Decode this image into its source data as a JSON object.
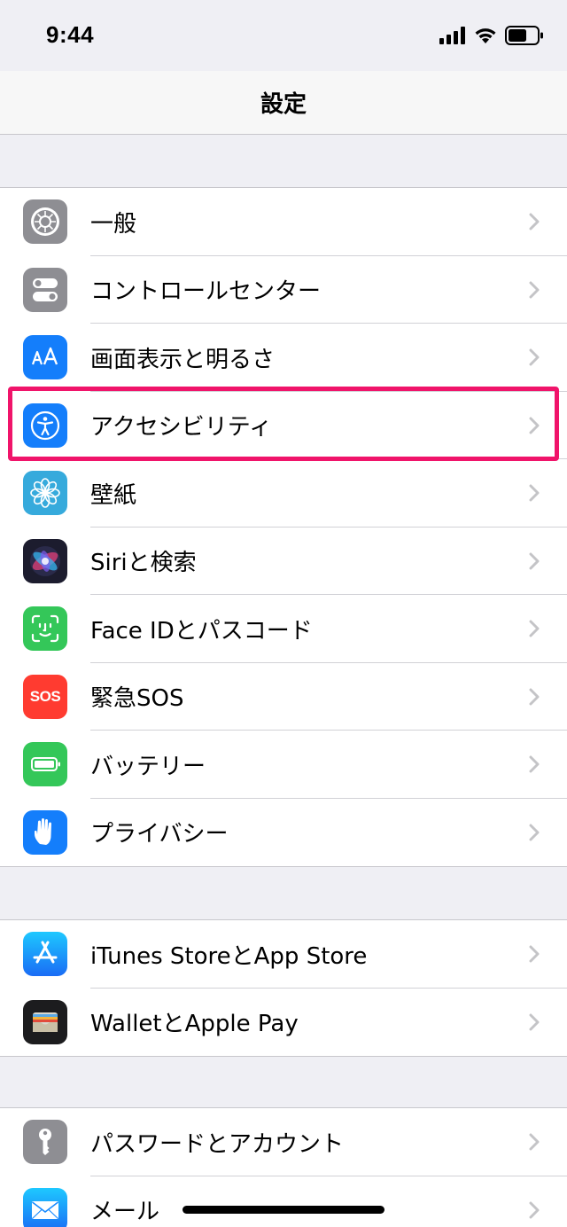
{
  "status": {
    "time": "9:44"
  },
  "nav": {
    "title": "設定"
  },
  "sections": [
    {
      "items": [
        {
          "label": "一般",
          "icon": "gear-icon",
          "color": "#8e8e93"
        },
        {
          "label": "コントロールセンター",
          "icon": "toggles-icon",
          "color": "#8e8e93"
        },
        {
          "label": "画面表示と明るさ",
          "icon": "text-size-icon",
          "color": "#147efb"
        },
        {
          "label": "アクセシビリティ",
          "icon": "accessibility-icon",
          "color": "#147efb"
        },
        {
          "label": "壁紙",
          "icon": "wallpaper-flower-icon",
          "color": "#36aadc"
        },
        {
          "label": "Siriと検索",
          "icon": "siri-icon",
          "color": "#1c1c2e"
        },
        {
          "label": "Face IDとパスコード",
          "icon": "face-id-icon",
          "color": "#34c759"
        },
        {
          "label": "緊急SOS",
          "icon": "sos-icon",
          "color": "#ff3b30",
          "icon_text": "SOS"
        },
        {
          "label": "バッテリー",
          "icon": "battery-icon",
          "color": "#34c759"
        },
        {
          "label": "プライバシー",
          "icon": "hand-icon",
          "color": "#147efb"
        }
      ]
    },
    {
      "items": [
        {
          "label": "iTunes StoreとApp Store",
          "icon": "app-store-icon",
          "color": "#1a8cff"
        },
        {
          "label": "WalletとApple Pay",
          "icon": "wallet-icon",
          "color": "#1c1c1e"
        }
      ]
    },
    {
      "items": [
        {
          "label": "パスワードとアカウント",
          "icon": "key-icon",
          "color": "#8e8e93"
        },
        {
          "label": "メール",
          "icon": "mail-icon",
          "color": "#1a8cff"
        }
      ]
    }
  ],
  "highlight_color": "#f0146a"
}
